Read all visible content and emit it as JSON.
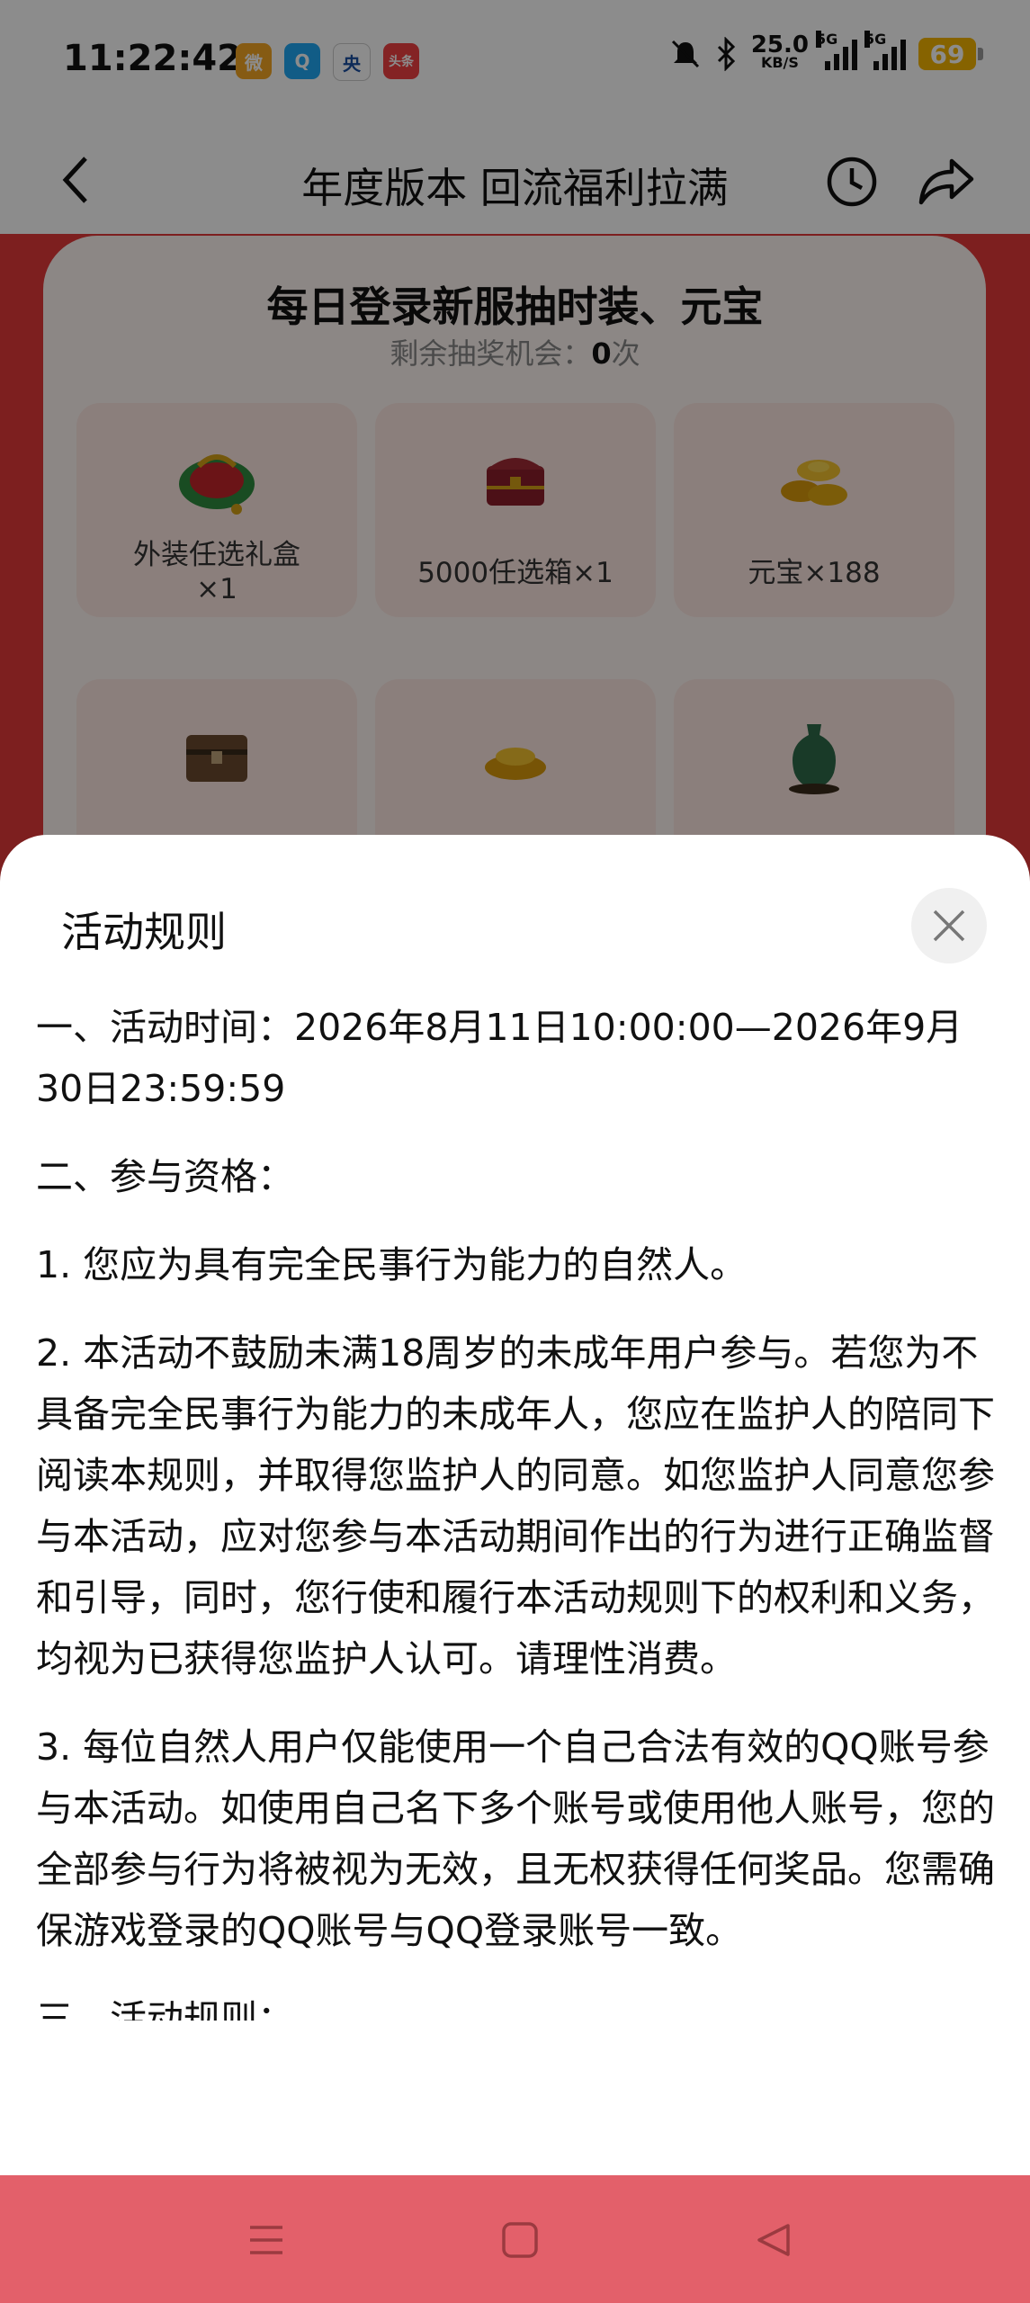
{
  "status_bar": {
    "time": "11:22:42",
    "apps": [
      {
        "name": "weibo-icon",
        "color": "#f5a623",
        "text": "微"
      },
      {
        "name": "qq-icon",
        "color": "#1fa8f4",
        "text": "Q"
      },
      {
        "name": "news-icon",
        "color": "#ffffff",
        "text": "央"
      },
      {
        "name": "toutiao-icon",
        "color": "#f04142",
        "text": "头条"
      }
    ],
    "speed_value": "25.0",
    "speed_unit": "KB/S",
    "network": "5G",
    "battery": "69"
  },
  "nav": {
    "title": "年度版本 回流福利拉满"
  },
  "panel": {
    "title": "每日登录新服抽时装、元宝",
    "remaining_label": "剩余抽奖机会：",
    "remaining_count": "0",
    "remaining_unit": "次",
    "prizes": [
      {
        "label": "外装任选礼盒\n×1",
        "icon": "gift-bundle-icon"
      },
      {
        "label": "5000任选箱×1",
        "icon": "treasure-chest-icon"
      },
      {
        "label": "元宝×188",
        "icon": "gold-ingot-icon"
      },
      {
        "label": "",
        "icon": "wooden-chest-icon"
      },
      {
        "label": "",
        "icon": "gold-ingot-icon"
      },
      {
        "label": "",
        "icon": "jade-vase-icon"
      }
    ]
  },
  "sheet": {
    "title": "活动规则",
    "rules": [
      "一、活动时间：2026年8月11日10:00:00—2026年9月30日23:59:59",
      "二、参与资格：",
      "1. 您应为具有完全民事行为能力的自然人。",
      "2. 本活动不鼓励未满18周岁的未成年用户参与。若您为不具备完全民事行为能力的未成年人，您应在监护人的陪同下阅读本规则，并取得您监护人的同意。如您监护人同意您参与本活动，应对您参与本活动期间作出的行为进行正确监督和引导，同时，您行使和履行本活动规则下的权利和义务，均视为已获得您监护人认可。请理性消费。",
      "3. 每位自然人用户仅能使用一个自己合法有效的QQ账号参与本活动。如使用自己名下多个账号或使用他人账号，您的全部参与行为将被视为无效，且无权获得任何奖品。您需确保游戏登录的QQ账号与QQ登录账号一致。",
      "三、活动规则："
    ]
  },
  "colors": {
    "accent_red": "#e3393a",
    "nav_bar_bottom": "#e3606a"
  }
}
